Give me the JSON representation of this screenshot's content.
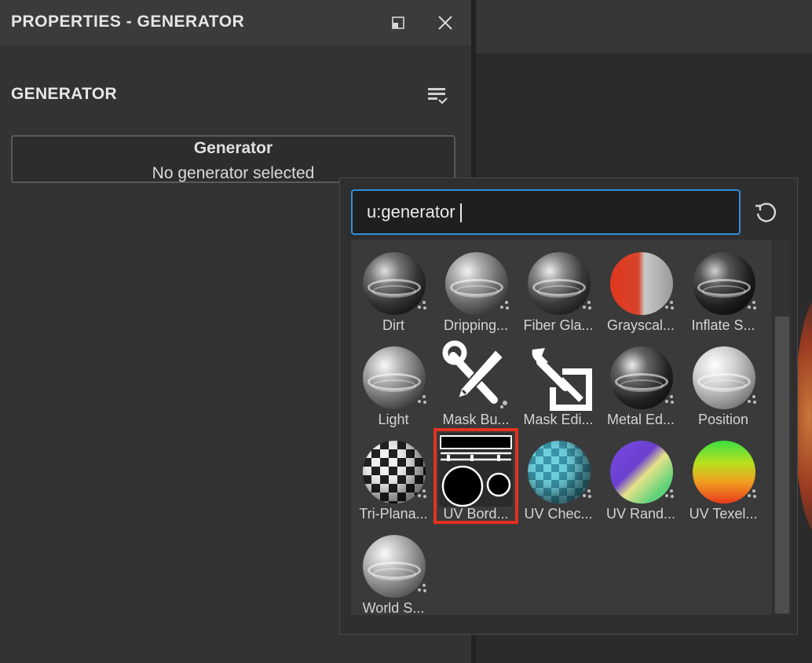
{
  "window": {
    "title": "PROPERTIES - GENERATOR",
    "buttons": {
      "restore": "restore-icon",
      "close": "close-icon"
    }
  },
  "section": {
    "title": "GENERATOR",
    "menu_icon": "list-menu-icon"
  },
  "generator_field": {
    "label": "Generator",
    "value": "No generator selected"
  },
  "popup": {
    "search_value": "u:generator",
    "refresh_icon": "refresh-icon",
    "accent": "#2f8fd8",
    "selected_color": "#e0321e",
    "items": [
      {
        "label": "Dirt",
        "style": "dirt"
      },
      {
        "label": "Dripping...",
        "style": "dripping"
      },
      {
        "label": "Fiber Gla...",
        "style": "fiber"
      },
      {
        "label": "Grayscal...",
        "style": "grayscale"
      },
      {
        "label": "Inflate S...",
        "style": "inflate"
      },
      {
        "label": "Light",
        "style": "light"
      },
      {
        "label": "Mask Bu...",
        "style": "maskbuilder"
      },
      {
        "label": "Mask Edi...",
        "style": "maskeditor"
      },
      {
        "label": "Metal Ed...",
        "style": "metal"
      },
      {
        "label": "Position",
        "style": "position"
      },
      {
        "label": "Tri-Plana...",
        "style": "triplanar"
      },
      {
        "label": "UV Bord...",
        "style": "uvborder",
        "selected": true
      },
      {
        "label": "UV Chec...",
        "style": "uvchecker"
      },
      {
        "label": "UV Rand...",
        "style": "uvrandom"
      },
      {
        "label": "UV Texel...",
        "style": "uvtexel"
      },
      {
        "label": "World S...",
        "style": "worldspace"
      }
    ]
  }
}
